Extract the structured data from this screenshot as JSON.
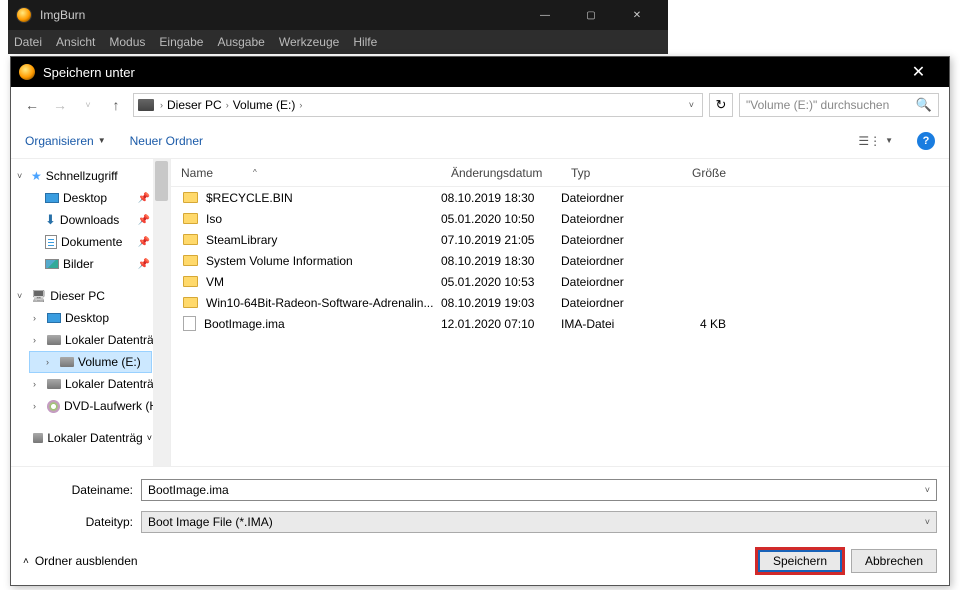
{
  "parent": {
    "title": "ImgBurn",
    "menu": [
      "Datei",
      "Ansicht",
      "Modus",
      "Eingabe",
      "Ausgabe",
      "Werkzeuge",
      "Hilfe"
    ]
  },
  "dialog": {
    "title": "Speichern unter",
    "breadcrumb": {
      "pc": "Dieser PC",
      "vol": "Volume (E:)"
    },
    "search_placeholder": "\"Volume (E:)\" durchsuchen",
    "organize": "Organisieren",
    "new_folder": "Neuer Ordner",
    "columns": {
      "name": "Name",
      "mod": "Änderungsdatum",
      "type": "Typ",
      "size": "Größe"
    },
    "tree": {
      "quick": "Schnellzugriff",
      "desktop": "Desktop",
      "downloads": "Downloads",
      "documents": "Dokumente",
      "pictures": "Bilder",
      "this_pc": "Dieser PC",
      "desktop2": "Desktop",
      "local1": "Lokaler Datenträ",
      "volume": "Volume (E:)",
      "local2": "Lokaler Datenträ",
      "dvd": "DVD-Laufwerk (H",
      "local3": "Lokaler Datenträg"
    },
    "rows": [
      {
        "name": "$RECYCLE.BIN",
        "mod": "08.10.2019 18:30",
        "type": "Dateiordner",
        "size": "",
        "folder": true
      },
      {
        "name": "Iso",
        "mod": "05.01.2020 10:50",
        "type": "Dateiordner",
        "size": "",
        "folder": true
      },
      {
        "name": "SteamLibrary",
        "mod": "07.10.2019 21:05",
        "type": "Dateiordner",
        "size": "",
        "folder": true
      },
      {
        "name": "System Volume Information",
        "mod": "08.10.2019 18:30",
        "type": "Dateiordner",
        "size": "",
        "folder": true
      },
      {
        "name": "VM",
        "mod": "05.01.2020 10:53",
        "type": "Dateiordner",
        "size": "",
        "folder": true
      },
      {
        "name": "Win10-64Bit-Radeon-Software-Adrenalin...",
        "mod": "08.10.2019 19:03",
        "type": "Dateiordner",
        "size": "",
        "folder": true
      },
      {
        "name": "BootImage.ima",
        "mod": "12.01.2020 07:10",
        "type": "IMA-Datei",
        "size": "4 KB",
        "folder": false
      }
    ],
    "filename_label": "Dateiname:",
    "filename_value": "BootImage.ima",
    "filetype_label": "Dateityp:",
    "filetype_value": "Boot Image File (*.IMA)",
    "hide_folders": "Ordner ausblenden",
    "save": "Speichern",
    "cancel": "Abbrechen"
  }
}
